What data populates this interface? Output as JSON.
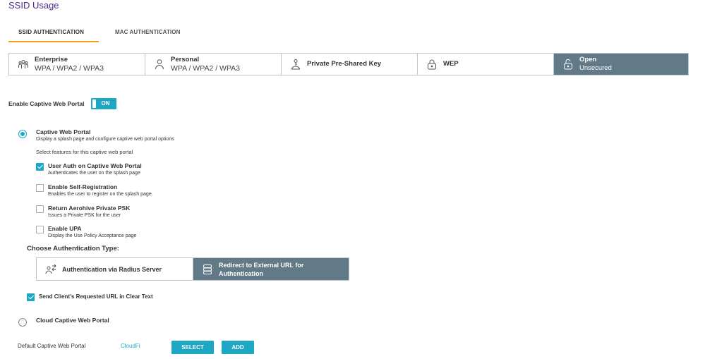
{
  "page": {
    "title": "SSID Usage"
  },
  "tabs": [
    {
      "label": "SSID AUTHENTICATION",
      "active": true
    },
    {
      "label": "MAC AUTHENTICATION",
      "active": false
    }
  ],
  "auth_options": [
    {
      "title": "Enterprise",
      "subtitle": "WPA / WPA2 / WPA3",
      "icon": "users-icon"
    },
    {
      "title": "Personal",
      "subtitle": "WPA / WPA2 / WPA3",
      "icon": "user-icon"
    },
    {
      "title": "Private Pre-Shared Key",
      "subtitle": "",
      "icon": "key-user-icon"
    },
    {
      "title": "WEP",
      "subtitle": "",
      "icon": "lock-icon"
    },
    {
      "title": "Open",
      "subtitle": "Unsecured",
      "icon": "unlock-icon",
      "active": true
    }
  ],
  "captive": {
    "label": "Enable Captive Web Portal",
    "toggle": "ON"
  },
  "portal_option": {
    "title": "Captive Web Portal",
    "subtitle": "Display a splash page and configure captive web portal options",
    "features_label": "Select features for this captive web portal"
  },
  "features": [
    {
      "title": "User Auth on Captive Web Portal",
      "subtitle": "Authenticates the user on the splash page",
      "checked": true
    },
    {
      "title": "Enable Self-Registration",
      "subtitle": "Enables the user to register on the splash page.",
      "checked": false
    },
    {
      "title": "Return Aerohive Private PSK",
      "subtitle": "Issues a Private PSK for the user",
      "checked": false
    },
    {
      "title": "Enable UPA",
      "subtitle": "Display the Use Policy Acceptance page",
      "checked": false
    }
  ],
  "auth_type": {
    "label": "Choose Authentication Type:",
    "radius": "Authentication via Radius Server",
    "redirect": "Redirect to External URL for Authentication"
  },
  "send_url": {
    "label": "Send Client's Requested URL in Clear Text",
    "checked": true
  },
  "cloud_option": {
    "title": "Cloud Captive Web Portal"
  },
  "default_portal": {
    "label": "Default Captive Web Portal",
    "value": "CloudFi",
    "select": "SELECT",
    "add": "ADD"
  },
  "colors": {
    "accent": "#1ea7c5",
    "tab_underline": "#f0a21e",
    "title": "#4b2d8a",
    "selected_bg": "#627a87"
  }
}
